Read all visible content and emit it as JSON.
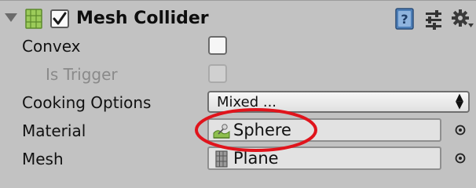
{
  "header": {
    "title": "Mesh Collider",
    "enabled": true,
    "icons": [
      "foldout-arrow-icon",
      "mesh-collider-icon",
      "help-icon",
      "presets-icon",
      "gear-icon"
    ]
  },
  "fields": {
    "convex": {
      "label": "Convex",
      "checked": false
    },
    "is_trigger": {
      "label": "Is Trigger",
      "checked": false,
      "disabled": true
    },
    "cooking_options": {
      "label": "Cooking Options",
      "value": "Mixed ..."
    },
    "material": {
      "label": "Material",
      "value": "Sphere",
      "icon": "physic-material-icon"
    },
    "mesh": {
      "label": "Mesh",
      "value": "Plane",
      "icon": "mesh-icon"
    }
  },
  "annotation": {
    "shape": "ellipse",
    "color": "#e0141c",
    "target": "material"
  },
  "colors": {
    "panel_bg": "#c2c2c2",
    "help_icon_blue": "#3f6fa6",
    "mesh_icon_green": "#8ebf4e"
  }
}
